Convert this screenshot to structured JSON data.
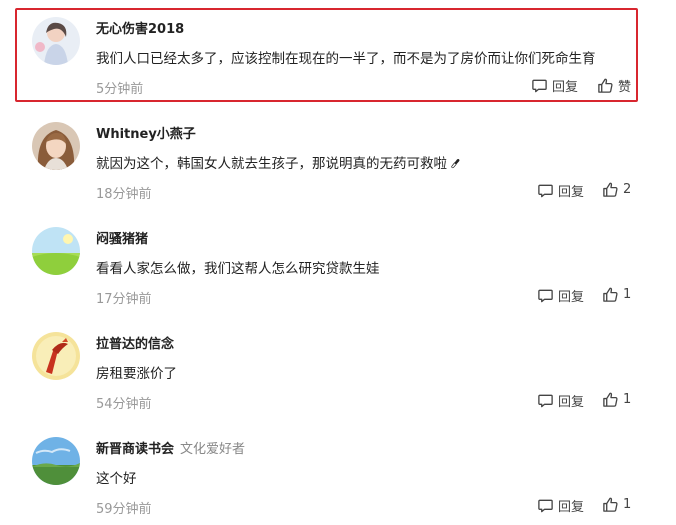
{
  "comments": [
    {
      "name": "无心伤害2018",
      "badge": "",
      "text": "我们人口已经太多了，应该控制在现在的一半了，而不是为了房价而让你们死命生育",
      "time": "5分钟前",
      "reply_label": "回复",
      "like_label": "赞",
      "highlighted": true
    },
    {
      "name": "Whitney小燕子",
      "badge": "",
      "text": "就因为这个，韩国女人就去生孩子，那说明真的无药可救啦",
      "time": "18分钟前",
      "reply_label": "回复",
      "like_label": "2"
    },
    {
      "name": "闷骚猪猪",
      "badge": "",
      "text": "看看人家怎么做，我们这帮人怎么研究贷款生娃",
      "time": "17分钟前",
      "reply_label": "回复",
      "like_label": "1"
    },
    {
      "name": "拉普达的信念",
      "badge": "",
      "text": "房租要涨价了",
      "time": "54分钟前",
      "reply_label": "回复",
      "like_label": "1"
    },
    {
      "name": "新晋商读书会",
      "badge": "文化爱好者",
      "text": "这个好",
      "time": "59分钟前",
      "reply_label": "回复",
      "like_label": "1"
    }
  ],
  "icons": {
    "reply": "comment-bubble-icon",
    "like": "thumbs-up-icon"
  },
  "colors": {
    "highlight_border": "#d8262f"
  }
}
